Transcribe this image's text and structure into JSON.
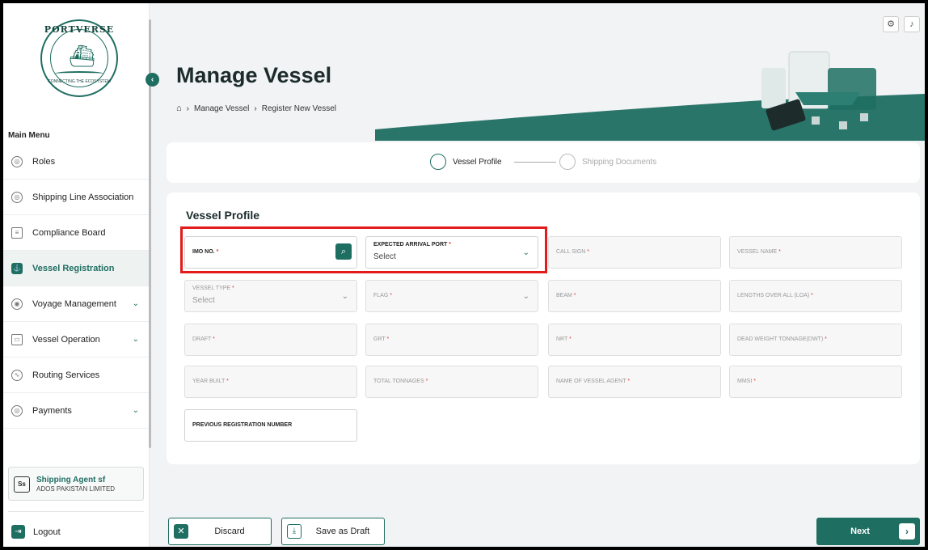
{
  "brand": {
    "name": "PORTVERSE",
    "tagline": "CONNECTING THE ECOSYSTEM"
  },
  "sidebar": {
    "menu_title": "Main Menu",
    "items": [
      {
        "label": "Roles",
        "icon": "roles-icon"
      },
      {
        "label": "Shipping Line Association",
        "icon": "association-icon"
      },
      {
        "label": "Compliance Board",
        "icon": "document-icon"
      },
      {
        "label": "Vessel Registration",
        "icon": "ship-icon",
        "active": true
      },
      {
        "label": "Voyage Management",
        "icon": "voyage-icon",
        "expandable": true
      },
      {
        "label": "Vessel Operation",
        "icon": "operation-icon",
        "expandable": true
      },
      {
        "label": "Routing Services",
        "icon": "route-icon"
      },
      {
        "label": "Payments",
        "icon": "payment-icon",
        "expandable": true
      }
    ],
    "user": {
      "initials": "Ss",
      "name": "Shipping Agent sf",
      "company": "ADOS PAKISTAN LIMITED"
    },
    "logout_label": "Logout"
  },
  "header": {
    "title": "Manage Vessel",
    "breadcrumb": [
      "Manage Vessel",
      "Register New Vessel"
    ]
  },
  "stepper": {
    "steps": [
      {
        "label": "Vessel Profile",
        "active": true
      },
      {
        "label": "Shipping Documents",
        "active": false
      }
    ]
  },
  "form": {
    "title": "Vessel Profile",
    "fields": {
      "imo": {
        "label": "IMO NO.",
        "required": "*",
        "value": ""
      },
      "arrival_port": {
        "label": "EXPECTED ARRIVAL PORT",
        "required": "*",
        "value": "Select"
      },
      "call_sign": {
        "label": "CALL SIGN",
        "required": "*"
      },
      "vessel_name": {
        "label": "VESSEL NAME",
        "required": "*"
      },
      "vessel_type": {
        "label": "VESSEL TYPE",
        "required": "*",
        "value": "Select"
      },
      "flag": {
        "label": "FLAG",
        "required": "*"
      },
      "beam": {
        "label": "BEAM",
        "required": "*"
      },
      "loa": {
        "label": "LENGTHS OVER ALL (LOA)",
        "required": "*"
      },
      "draft": {
        "label": "DRAFT",
        "required": "*"
      },
      "grt": {
        "label": "GRT",
        "required": "*"
      },
      "nrt": {
        "label": "NRT",
        "required": "*"
      },
      "dwt": {
        "label": "DEAD WEIGHT TONNAGE(DWT)",
        "required": "*"
      },
      "year_built": {
        "label": "YEAR BUILT",
        "required": "*"
      },
      "total_tonnages": {
        "label": "TOTAL TONNAGES",
        "required": "*"
      },
      "vessel_agent": {
        "label": "NAME OF VESSEL AGENT",
        "required": "*"
      },
      "mmsi": {
        "label": "MMSI",
        "required": "*"
      },
      "prev_reg": {
        "label": "PREVIOUS REGISTRATION NUMBER"
      }
    }
  },
  "actions": {
    "discard": "Discard",
    "save_draft": "Save as Draft",
    "next": "Next"
  },
  "colors": {
    "primary": "#1f6e62",
    "highlight": "#e21b1b",
    "required": "#e03a3a"
  }
}
